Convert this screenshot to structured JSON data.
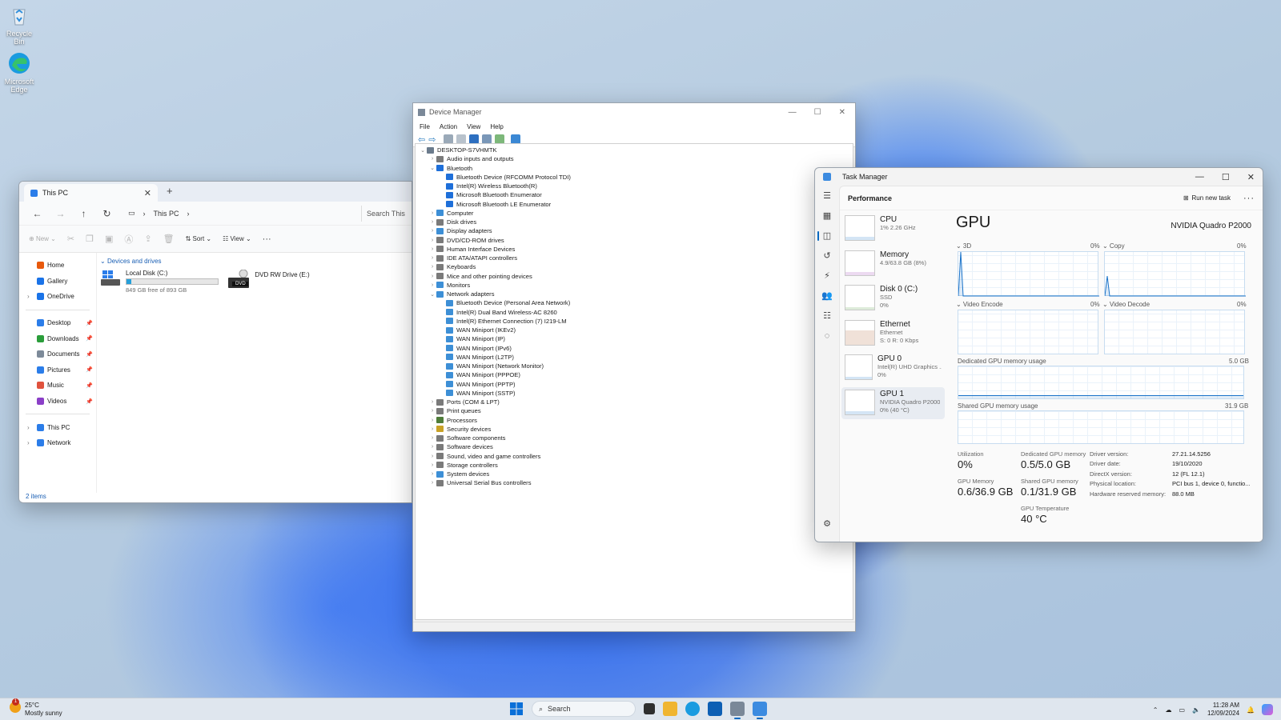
{
  "desktop": {
    "icons": [
      {
        "label": "Recycle Bin",
        "icon": "recycle-bin-icon"
      },
      {
        "label": "Microsoft Edge",
        "icon": "edge-icon"
      }
    ]
  },
  "explorer": {
    "tab_title": "This PC",
    "address": "This PC",
    "search_placeholder": "Search This PC",
    "toolbar": {
      "new": "New",
      "sort": "Sort",
      "view": "View",
      "more": "···"
    },
    "sidebar": [
      {
        "label": "Home",
        "color": "#e8590c",
        "pinned": false,
        "chevron": false
      },
      {
        "label": "Gallery",
        "color": "#1a73e8",
        "pinned": false,
        "chevron": false
      },
      {
        "label": "OneDrive",
        "color": "#1a73e8",
        "pinned": false,
        "chevron": true
      }
    ],
    "sidebar_pinned": [
      {
        "label": "Desktop",
        "color": "#2b7de9"
      },
      {
        "label": "Downloads",
        "color": "#2a9d3a"
      },
      {
        "label": "Documents",
        "color": "#7d8a99"
      },
      {
        "label": "Pictures",
        "color": "#2b7de9"
      },
      {
        "label": "Music",
        "color": "#e0523d"
      },
      {
        "label": "Videos",
        "color": "#8b3fc7"
      }
    ],
    "sidebar_bottom": [
      {
        "label": "This PC",
        "color": "#2b7de9"
      },
      {
        "label": "Network",
        "color": "#2b7de9"
      }
    ],
    "group_header": "Devices and drives",
    "drives": [
      {
        "name": "Local Disk (C:)",
        "free": "849 GB free of 893 GB",
        "used_fraction": 0.05
      },
      {
        "name": "DVD RW Drive (E:)",
        "badge": "DVD"
      }
    ],
    "status": "2 items"
  },
  "devmgr": {
    "title": "Device Manager",
    "menu": [
      "File",
      "Action",
      "View",
      "Help"
    ],
    "tree": [
      {
        "level": 0,
        "exp": "v",
        "label": "DESKTOP-S7VHMTK",
        "color": "#6b7b8c"
      },
      {
        "level": 1,
        "exp": ">",
        "label": "Audio inputs and outputs",
        "color": "#7a7a7a"
      },
      {
        "level": 1,
        "exp": "v",
        "label": "Bluetooth",
        "color": "#1e6fd9"
      },
      {
        "level": 2,
        "exp": "",
        "label": "Bluetooth Device (RFCOMM Protocol TDI)",
        "color": "#1e6fd9"
      },
      {
        "level": 2,
        "exp": "",
        "label": "Intel(R) Wireless Bluetooth(R)",
        "color": "#1e6fd9"
      },
      {
        "level": 2,
        "exp": "",
        "label": "Microsoft Bluetooth Enumerator",
        "color": "#1e6fd9"
      },
      {
        "level": 2,
        "exp": "",
        "label": "Microsoft Bluetooth LE Enumerator",
        "color": "#1e6fd9"
      },
      {
        "level": 1,
        "exp": ">",
        "label": "Computer",
        "color": "#3d8fd6"
      },
      {
        "level": 1,
        "exp": ">",
        "label": "Disk drives",
        "color": "#7a7a7a"
      },
      {
        "level": 1,
        "exp": ">",
        "label": "Display adapters",
        "color": "#3d8fd6"
      },
      {
        "level": 1,
        "exp": ">",
        "label": "DVD/CD-ROM drives",
        "color": "#7a7a7a"
      },
      {
        "level": 1,
        "exp": ">",
        "label": "Human Interface Devices",
        "color": "#7a7a7a"
      },
      {
        "level": 1,
        "exp": ">",
        "label": "IDE ATA/ATAPI controllers",
        "color": "#7a7a7a"
      },
      {
        "level": 1,
        "exp": ">",
        "label": "Keyboards",
        "color": "#7a7a7a"
      },
      {
        "level": 1,
        "exp": ">",
        "label": "Mice and other pointing devices",
        "color": "#7a7a7a"
      },
      {
        "level": 1,
        "exp": ">",
        "label": "Monitors",
        "color": "#3d8fd6"
      },
      {
        "level": 1,
        "exp": "v",
        "label": "Network adapters",
        "color": "#3d8fd6"
      },
      {
        "level": 2,
        "exp": "",
        "label": "Bluetooth Device (Personal Area Network)",
        "color": "#3d8fd6"
      },
      {
        "level": 2,
        "exp": "",
        "label": "Intel(R) Dual Band Wireless-AC 8260",
        "color": "#3d8fd6"
      },
      {
        "level": 2,
        "exp": "",
        "label": "Intel(R) Ethernet Connection (7) I219-LM",
        "color": "#3d8fd6"
      },
      {
        "level": 2,
        "exp": "",
        "label": "WAN Miniport (IKEv2)",
        "color": "#3d8fd6"
      },
      {
        "level": 2,
        "exp": "",
        "label": "WAN Miniport (IP)",
        "color": "#3d8fd6"
      },
      {
        "level": 2,
        "exp": "",
        "label": "WAN Miniport (IPv6)",
        "color": "#3d8fd6"
      },
      {
        "level": 2,
        "exp": "",
        "label": "WAN Miniport (L2TP)",
        "color": "#3d8fd6"
      },
      {
        "level": 2,
        "exp": "",
        "label": "WAN Miniport (Network Monitor)",
        "color": "#3d8fd6"
      },
      {
        "level": 2,
        "exp": "",
        "label": "WAN Miniport (PPPOE)",
        "color": "#3d8fd6"
      },
      {
        "level": 2,
        "exp": "",
        "label": "WAN Miniport (PPTP)",
        "color": "#3d8fd6"
      },
      {
        "level": 2,
        "exp": "",
        "label": "WAN Miniport (SSTP)",
        "color": "#3d8fd6"
      },
      {
        "level": 1,
        "exp": ">",
        "label": "Ports (COM & LPT)",
        "color": "#7a7a7a"
      },
      {
        "level": 1,
        "exp": ">",
        "label": "Print queues",
        "color": "#7a7a7a"
      },
      {
        "level": 1,
        "exp": ">",
        "label": "Processors",
        "color": "#4f7d3a"
      },
      {
        "level": 1,
        "exp": ">",
        "label": "Security devices",
        "color": "#c9a227"
      },
      {
        "level": 1,
        "exp": ">",
        "label": "Software components",
        "color": "#7a7a7a"
      },
      {
        "level": 1,
        "exp": ">",
        "label": "Software devices",
        "color": "#7a7a7a"
      },
      {
        "level": 1,
        "exp": ">",
        "label": "Sound, video and game controllers",
        "color": "#7a7a7a"
      },
      {
        "level": 1,
        "exp": ">",
        "label": "Storage controllers",
        "color": "#7a7a7a"
      },
      {
        "level": 1,
        "exp": ">",
        "label": "System devices",
        "color": "#3d8fd6"
      },
      {
        "level": 1,
        "exp": ">",
        "label": "Universal Serial Bus controllers",
        "color": "#7a7a7a"
      }
    ]
  },
  "taskmgr": {
    "title": "Task Manager",
    "page": "Performance",
    "run_new_task": "Run new task",
    "more": "···",
    "items": [
      {
        "name": "CPU",
        "sub1": "1%  2.26 GHz",
        "sub2": "",
        "sub3": "",
        "accent": "#1a73c9"
      },
      {
        "name": "Memory",
        "sub1": "4.9/63.8 GB (8%)",
        "sub2": "",
        "sub3": "",
        "accent": "#9b37b5"
      },
      {
        "name": "Disk 0 (C:)",
        "sub1": "SSD",
        "sub2": "0%",
        "sub3": "",
        "accent": "#4f9a3a"
      },
      {
        "name": "Ethernet",
        "sub1": "Ethernet",
        "sub2": "S: 0  R: 0 Kbps",
        "sub3": "",
        "accent": "#b0612f"
      },
      {
        "name": "GPU 0",
        "sub1": "Intel(R) UHD Graphics ...",
        "sub2": "0%",
        "sub3": "",
        "accent": "#1a73c9"
      },
      {
        "name": "GPU 1",
        "sub1": "NVIDIA Quadro P2000",
        "sub2": "0%  (40 °C)",
        "sub3": "",
        "accent": "#1a73c9"
      }
    ],
    "gpu": {
      "title": "GPU",
      "model": "NVIDIA Quadro P2000",
      "engines": [
        {
          "label": "3D",
          "pct": "0%"
        },
        {
          "label": "Copy",
          "pct": "0%"
        },
        {
          "label": "Video Encode",
          "pct": "0%"
        },
        {
          "label": "Video Decode",
          "pct": "0%"
        }
      ],
      "dedicated_label": "Dedicated GPU memory usage",
      "dedicated_max": "5.0 GB",
      "shared_label": "Shared GPU memory usage",
      "shared_max": "31.9 GB",
      "stats": [
        {
          "label": "Utilization",
          "value": "0%"
        },
        {
          "label": "Dedicated GPU memory",
          "value": "0.5/5.0 GB"
        },
        {
          "label": "GPU Memory",
          "value": "0.6/36.9 GB"
        },
        {
          "label": "Shared GPU memory",
          "value": "0.1/31.9 GB"
        },
        {
          "label": "GPU Temperature",
          "value": "40 °C"
        }
      ],
      "details": [
        {
          "k": "Driver version:",
          "v": "27.21.14.5256"
        },
        {
          "k": "Driver date:",
          "v": "19/10/2020"
        },
        {
          "k": "DirectX version:",
          "v": "12 (FL 12.1)"
        },
        {
          "k": "Physical location:",
          "v": "PCI bus 1, device 0, functio..."
        },
        {
          "k": "Hardware reserved memory:",
          "v": "88.0 MB"
        }
      ]
    }
  },
  "taskbar": {
    "weather_temp": "25°C",
    "weather_desc": "Mostly sunny",
    "weather_badge": "1",
    "search": "Search",
    "time": "11:28 AM",
    "date": "12/09/2024"
  }
}
